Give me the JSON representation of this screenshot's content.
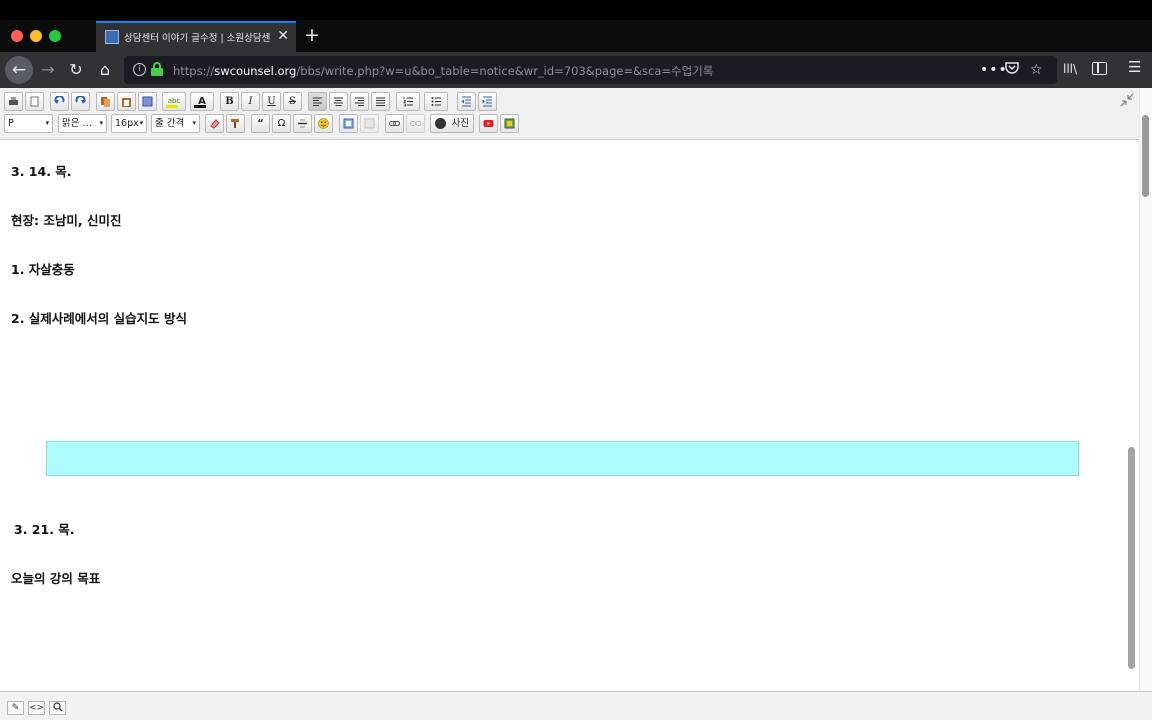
{
  "browser": {
    "tab": {
      "title": "상담센터 이야기 글수정 | 소원상담센",
      "close": "✕"
    },
    "new_tab": "+",
    "url": {
      "prefix": "https://",
      "host": "swcounsel.org",
      "path": "/bbs/write.php?w=u&bo_table=notice&wr_id=703&page=&sca=수업기록"
    },
    "more": "•••",
    "nav": {
      "back": "←",
      "forward": "→",
      "reload": "↻",
      "home": "⌂"
    },
    "library": "lll\\",
    "menu": "☰"
  },
  "editor": {
    "toolbar": {
      "bold": "B",
      "italic": "I",
      "underline": "U",
      "strike": "S",
      "format_select": "P",
      "font_select": "맑은 …",
      "size_select": "16px",
      "line_height_select": "줄 간격",
      "quote": "“",
      "special_char": "Ω",
      "photo_button": "사진",
      "font_color": "A",
      "highlight": "abc"
    },
    "content": {
      "line1": "3. 14. 목.",
      "line2": "현장: 조남미, 신미진",
      "line3": "1. 자살충동",
      "line4": "2. 실제사례에서의 실습지도 방식",
      "line5": "3. 21. 목.",
      "line6": "오늘의 강의 목표"
    },
    "highlight_color": "#aefcfb",
    "bottom": {
      "edit": "✎",
      "source": "<>",
      "preview": "🔍"
    }
  }
}
